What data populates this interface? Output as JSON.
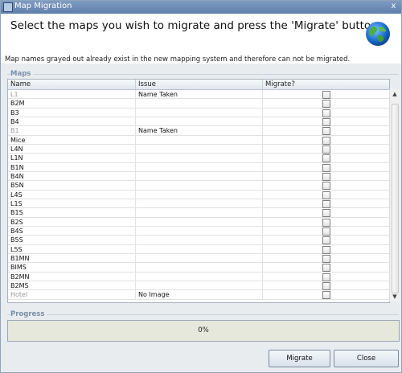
{
  "window": {
    "title": "Map Migration",
    "close_glyph": "x"
  },
  "header": {
    "heading": "Select the maps you wish to migrate and press the 'Migrate' button.",
    "icon": "globe-icon"
  },
  "note": "Map names grayed out already exist in the new mapping system and therefore can not be migrated.",
  "maps_group": {
    "label": "Maps",
    "columns": [
      "Name",
      "Issue",
      "Migrate?"
    ],
    "rows": [
      {
        "name": "L1",
        "issue": "Name Taken",
        "greyed": true,
        "checked": false
      },
      {
        "name": "B2M",
        "issue": "",
        "greyed": false,
        "checked": false
      },
      {
        "name": "B3",
        "issue": "",
        "greyed": false,
        "checked": false
      },
      {
        "name": "B4",
        "issue": "",
        "greyed": false,
        "checked": false
      },
      {
        "name": "B1",
        "issue": "Name Taken",
        "greyed": true,
        "checked": false
      },
      {
        "name": "Mice",
        "issue": "",
        "greyed": false,
        "checked": false
      },
      {
        "name": "L4N",
        "issue": "",
        "greyed": false,
        "checked": false
      },
      {
        "name": "L1N",
        "issue": "",
        "greyed": false,
        "checked": false
      },
      {
        "name": "B1N",
        "issue": "",
        "greyed": false,
        "checked": false
      },
      {
        "name": "B4N",
        "issue": "",
        "greyed": false,
        "checked": false
      },
      {
        "name": "B5N",
        "issue": "",
        "greyed": false,
        "checked": false
      },
      {
        "name": "L4S",
        "issue": "",
        "greyed": false,
        "checked": false
      },
      {
        "name": "L1S",
        "issue": "",
        "greyed": false,
        "checked": false
      },
      {
        "name": "B1S",
        "issue": "",
        "greyed": false,
        "checked": false
      },
      {
        "name": "B2S",
        "issue": "",
        "greyed": false,
        "checked": false
      },
      {
        "name": "B4S",
        "issue": "",
        "greyed": false,
        "checked": false
      },
      {
        "name": "B5S",
        "issue": "",
        "greyed": false,
        "checked": false
      },
      {
        "name": "L5S",
        "issue": "",
        "greyed": false,
        "checked": false
      },
      {
        "name": "B1MN",
        "issue": "",
        "greyed": false,
        "checked": false
      },
      {
        "name": "BIMS",
        "issue": "",
        "greyed": false,
        "checked": false
      },
      {
        "name": "B2MN",
        "issue": "",
        "greyed": false,
        "checked": false
      },
      {
        "name": "B2MS",
        "issue": "",
        "greyed": false,
        "checked": false
      },
      {
        "name": "Hotel",
        "issue": "No Image",
        "greyed": true,
        "checked": false
      }
    ]
  },
  "scrollbar": {
    "up_glyph": "▲",
    "down_glyph": "▼"
  },
  "progress_group": {
    "label": "Progress",
    "value_text": "0%",
    "value": 0
  },
  "buttons": {
    "migrate": "Migrate",
    "close": "Close"
  }
}
